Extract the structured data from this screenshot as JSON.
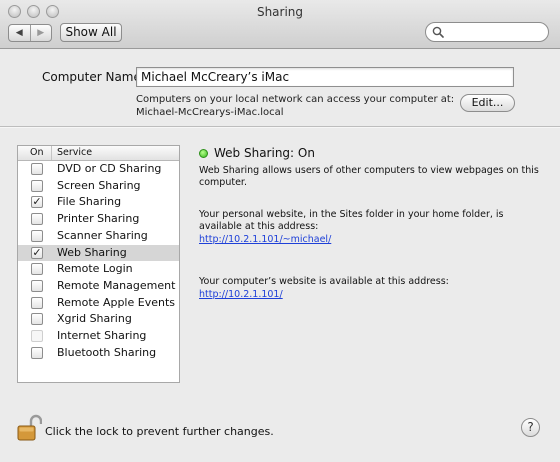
{
  "window": {
    "title": "Sharing"
  },
  "toolbar": {
    "back_glyph": "◀",
    "forward_glyph": "▶",
    "show_all_label": "Show All",
    "search_value": "",
    "search_placeholder": ""
  },
  "computer": {
    "label": "Computer Name:",
    "name": "Michael McCreary’s iMac",
    "description_line1": "Computers on your local network can access your computer at:",
    "description_line2": "Michael-McCrearys-iMac.local",
    "edit_label": "Edit..."
  },
  "services": {
    "header_on": "On",
    "header_service": "Service",
    "selected_index": 5,
    "items": [
      {
        "name": "DVD or CD Sharing",
        "checked": false,
        "enabled": true
      },
      {
        "name": "Screen Sharing",
        "checked": false,
        "enabled": true
      },
      {
        "name": "File Sharing",
        "checked": true,
        "enabled": true
      },
      {
        "name": "Printer Sharing",
        "checked": false,
        "enabled": true
      },
      {
        "name": "Scanner Sharing",
        "checked": false,
        "enabled": true
      },
      {
        "name": "Web Sharing",
        "checked": true,
        "enabled": true
      },
      {
        "name": "Remote Login",
        "checked": false,
        "enabled": true
      },
      {
        "name": "Remote Management",
        "checked": false,
        "enabled": true
      },
      {
        "name": "Remote Apple Events",
        "checked": false,
        "enabled": true
      },
      {
        "name": "Xgrid Sharing",
        "checked": false,
        "enabled": true
      },
      {
        "name": "Internet Sharing",
        "checked": false,
        "enabled": false
      },
      {
        "name": "Bluetooth Sharing",
        "checked": false,
        "enabled": true
      }
    ]
  },
  "detail": {
    "status": "Web Sharing: On",
    "status_color": "#38b81f",
    "description": "Web Sharing allows users of other computers to view webpages on this computer.",
    "personal_text": "Your personal website, in the Sites folder in your home folder, is available at this address:",
    "personal_url": "http://10.2.1.101/~michael/",
    "computer_text": "Your computer’s website is available at this address:",
    "computer_url": "http://10.2.1.101/",
    "link_color": "#1e40d8"
  },
  "footer": {
    "lock_text": "Click the lock to prevent further changes.",
    "help_glyph": "?"
  }
}
